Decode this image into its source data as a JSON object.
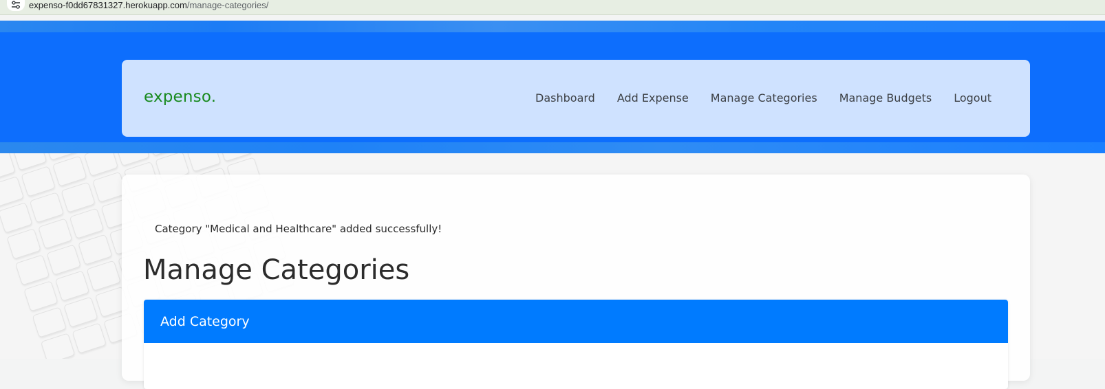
{
  "browser": {
    "url_host": "expenso-f0dd67831327.herokuapp.com",
    "url_path": "/manage-categories/",
    "site_info_icon": "tune-icon"
  },
  "navbar": {
    "brand": "expenso.",
    "links": [
      {
        "label": "Dashboard"
      },
      {
        "label": "Add Expense"
      },
      {
        "label": "Manage Categories"
      },
      {
        "label": "Manage Budgets"
      },
      {
        "label": "Logout"
      }
    ]
  },
  "main": {
    "alert_message": "Category \"Medical and Healthcare\" added successfully!",
    "page_title": "Manage Categories",
    "card_title": "Add Category"
  },
  "colors": {
    "header_blue": "#0d6efd",
    "navbar_bg": "#cfe2ff",
    "brand_green": "#198a1f",
    "card_header_blue": "#007bff"
  }
}
